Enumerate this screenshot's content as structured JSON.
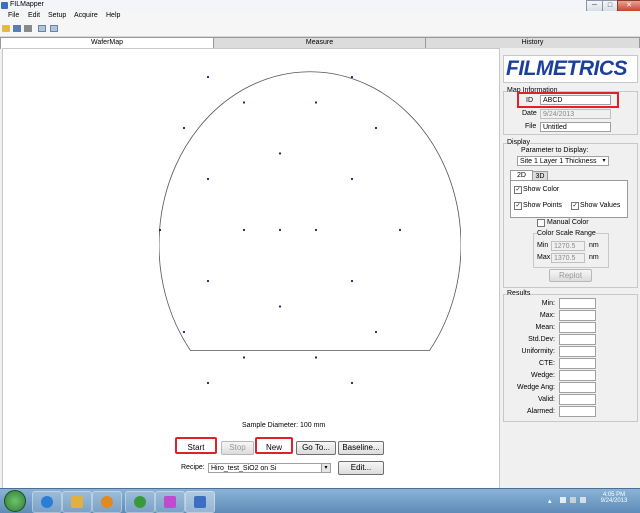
{
  "window": {
    "title": "FILMapper",
    "min": "─",
    "max": "□",
    "close": "✕"
  },
  "menu": [
    {
      "id": "file",
      "label": "File"
    },
    {
      "id": "edit",
      "label": "Edit"
    },
    {
      "id": "setup",
      "label": "Setup"
    },
    {
      "id": "acquire",
      "label": "Acquire"
    },
    {
      "id": "help",
      "label": "Help"
    }
  ],
  "toolbar_icons": [
    "open-folder-icon",
    "save-icon",
    "print-icon",
    "copy-icon",
    "paste-icon"
  ],
  "tabs": [
    {
      "id": "wafermap",
      "label": "WaferMap",
      "active": true
    },
    {
      "id": "measure",
      "label": "Measure"
    },
    {
      "id": "history",
      "label": "History"
    }
  ],
  "wafer": {
    "sample_diameter": "Sample Diameter: 100 mm",
    "points": [
      [
        0,
        2
      ],
      [
        -1.5,
        1.5
      ],
      [
        1.5,
        1.5
      ],
      [
        -0.75,
        1.25
      ],
      [
        0.75,
        1.25
      ],
      [
        -2,
        1
      ],
      [
        2,
        1
      ],
      [
        0,
        0.75
      ],
      [
        -1.5,
        0.5
      ],
      [
        1.5,
        0.5
      ],
      [
        -2.5,
        0
      ],
      [
        -0.75,
        0
      ],
      [
        0,
        0
      ],
      [
        0.75,
        0
      ],
      [
        2.5,
        0
      ],
      [
        -1.5,
        -0.5
      ],
      [
        1.5,
        -0.5
      ],
      [
        0,
        -0.75
      ],
      [
        -2,
        -1
      ],
      [
        2,
        -1
      ],
      [
        -0.75,
        -1.25
      ],
      [
        0.75,
        -1.25
      ],
      [
        -1.5,
        -1.5
      ],
      [
        1.5,
        -1.5
      ],
      [
        0,
        -2
      ]
    ]
  },
  "controls": {
    "start": "Start",
    "stop": "Stop",
    "new": "New",
    "goto": "Go To...",
    "baseline": "Baseline...",
    "recipe_label": "Recipe:",
    "recipe_value": "Hiro_test_SiO2 on Si",
    "edit": "Edit..."
  },
  "brand": {
    "logo": "FILMETRICS",
    "color": "#1a3f9c"
  },
  "map_info": {
    "title": "Map Information",
    "id_label": "ID",
    "id_value": "ABCD",
    "date_label": "Date",
    "date_value": "9/24/2013",
    "file_label": "File",
    "file_value": "Untitled"
  },
  "display": {
    "title": "Display",
    "param_label": "Parameter to Display:",
    "param_value": "Site 1 Layer 1 Thickness",
    "tab_2d": "2D",
    "tab_3d": "3D",
    "show_color": "Show Color",
    "show_points": "Show Points",
    "show_values": "Show Values",
    "manual_color": "Manual Color",
    "color_scale_range": "Color Scale Range",
    "min_label": "Min",
    "min_value": "1270.5",
    "max_label": "Max",
    "max_value": "1370.5",
    "unit": "nm",
    "replot": "Replot",
    "check": "✓"
  },
  "results": {
    "title": "Results",
    "rows": [
      "Min:",
      "Max:",
      "Mean:",
      "Std.Dev:",
      "Uniformity:",
      "CTE:",
      "Wedge:",
      "Wedge Ang:",
      "Valid:",
      "Alarmed:"
    ]
  },
  "taskbar": {
    "time": "4:05 PM",
    "date": "9/24/2013",
    "apps": [
      {
        "name": "start-orb-icon",
        "color": "#2e7d32"
      },
      {
        "name": "internet-explorer-icon",
        "color": "#2a7fd4"
      },
      {
        "name": "folder-icon",
        "color": "#e0b040"
      },
      {
        "name": "media-player-icon",
        "color": "#e08a20"
      },
      {
        "name": "globe-icon",
        "color": "#3a9a3a"
      },
      {
        "name": "paint-icon",
        "color": "#c04ad0"
      },
      {
        "name": "filmapper-icon",
        "color": "#3a6fc4"
      }
    ]
  }
}
